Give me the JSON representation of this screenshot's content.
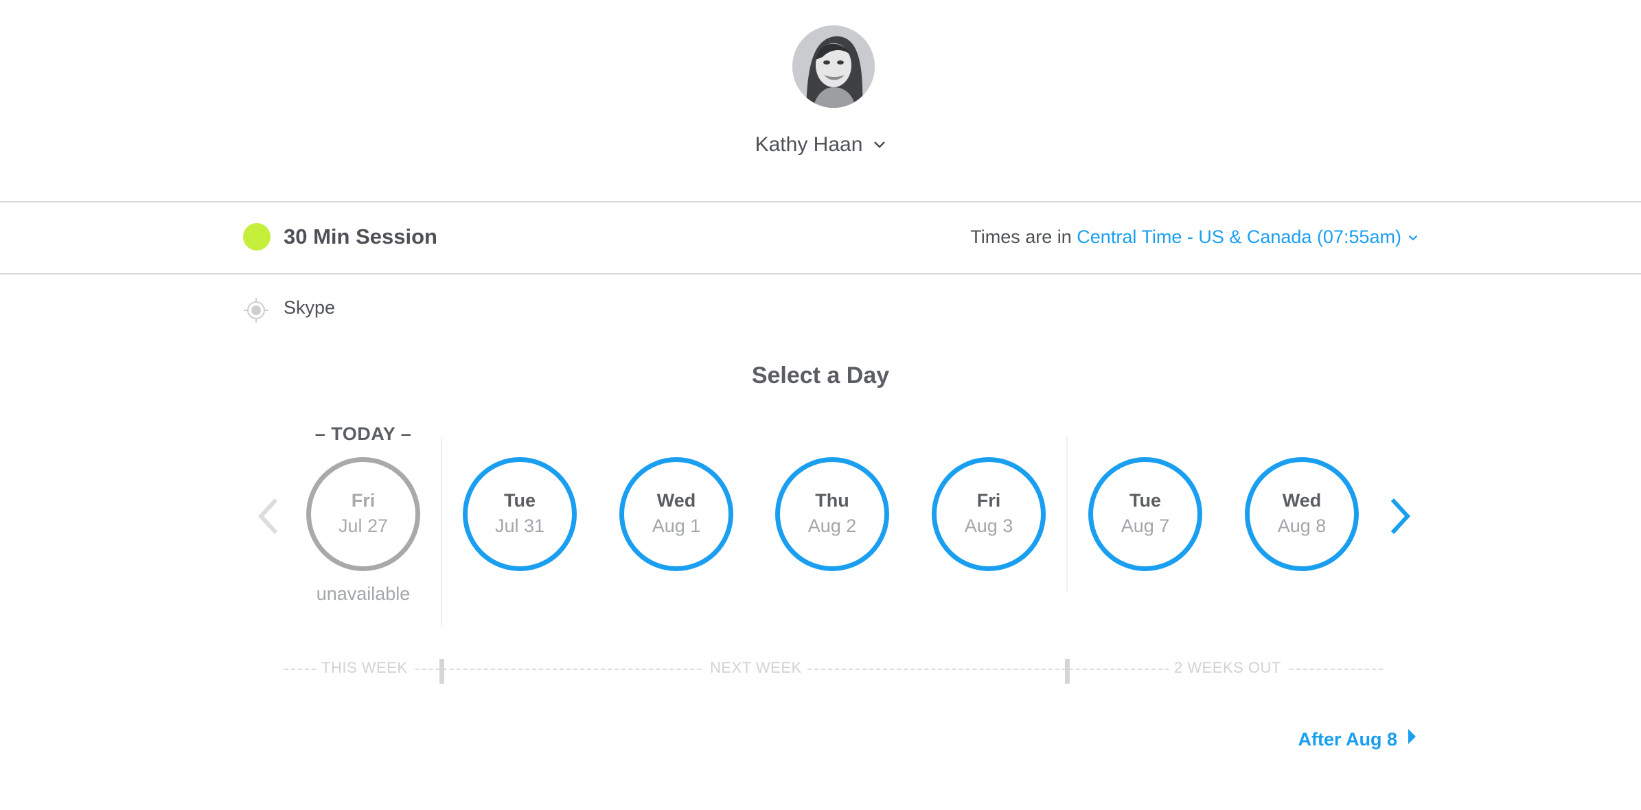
{
  "host": {
    "name": "Kathy Haan"
  },
  "event": {
    "name": "30 Min Session",
    "color": "#c6ef3b"
  },
  "timezone": {
    "prefix": "Times are in",
    "value": "Central Time - US & Canada (07:55am)"
  },
  "location": {
    "label": "Skype"
  },
  "calendar": {
    "title": "Select a Day",
    "today_label": "– TODAY –",
    "unavailable_label": "unavailable",
    "days": [
      {
        "dow": "Fri",
        "date": "Jul 27",
        "available": false
      },
      {
        "dow": "Tue",
        "date": "Jul 31",
        "available": true
      },
      {
        "dow": "Wed",
        "date": "Aug 1",
        "available": true
      },
      {
        "dow": "Thu",
        "date": "Aug 2",
        "available": true
      },
      {
        "dow": "Fri",
        "date": "Aug 3",
        "available": true
      },
      {
        "dow": "Tue",
        "date": "Aug 7",
        "available": true
      },
      {
        "dow": "Wed",
        "date": "Aug 8",
        "available": true
      }
    ],
    "weeks": [
      "THIS WEEK",
      "NEXT WEEK",
      "2 WEEKS OUT"
    ],
    "after_link": "After Aug 8"
  },
  "colors": {
    "accent": "#1a9ff0",
    "unavailable": "#a9a9a9"
  }
}
